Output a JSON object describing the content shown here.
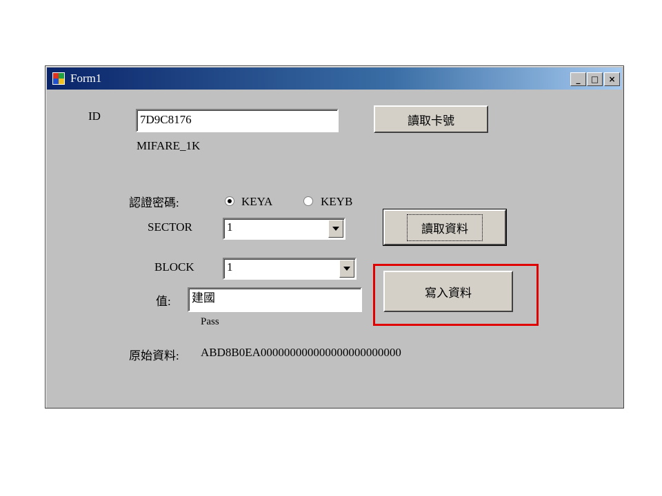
{
  "window": {
    "title": "Form1"
  },
  "titlebar_buttons": {
    "minimize": "_",
    "maximize": "□",
    "close": "×"
  },
  "id_label": "ID",
  "id_value": "7D9C8176",
  "card_type": "MIFARE_1K",
  "read_card_button": "讀取卡號",
  "auth_label": "認證密碼:",
  "key_options": [
    {
      "label": "KEYA",
      "checked": true
    },
    {
      "label": "KEYB",
      "checked": false
    }
  ],
  "sector": {
    "label": "SECTOR",
    "value": "1"
  },
  "block": {
    "label": "BLOCK",
    "value": "1"
  },
  "value": {
    "label": "值:",
    "text": "建國"
  },
  "status": "Pass",
  "read_data_button": "讀取資料",
  "write_data_button": "寫入資料",
  "raw_data": {
    "label": "原始資料:",
    "value": "ABD8B0EA000000000000000000000000"
  },
  "accent": {
    "highlight": "#e00000",
    "titlebar": "#0a246a"
  }
}
